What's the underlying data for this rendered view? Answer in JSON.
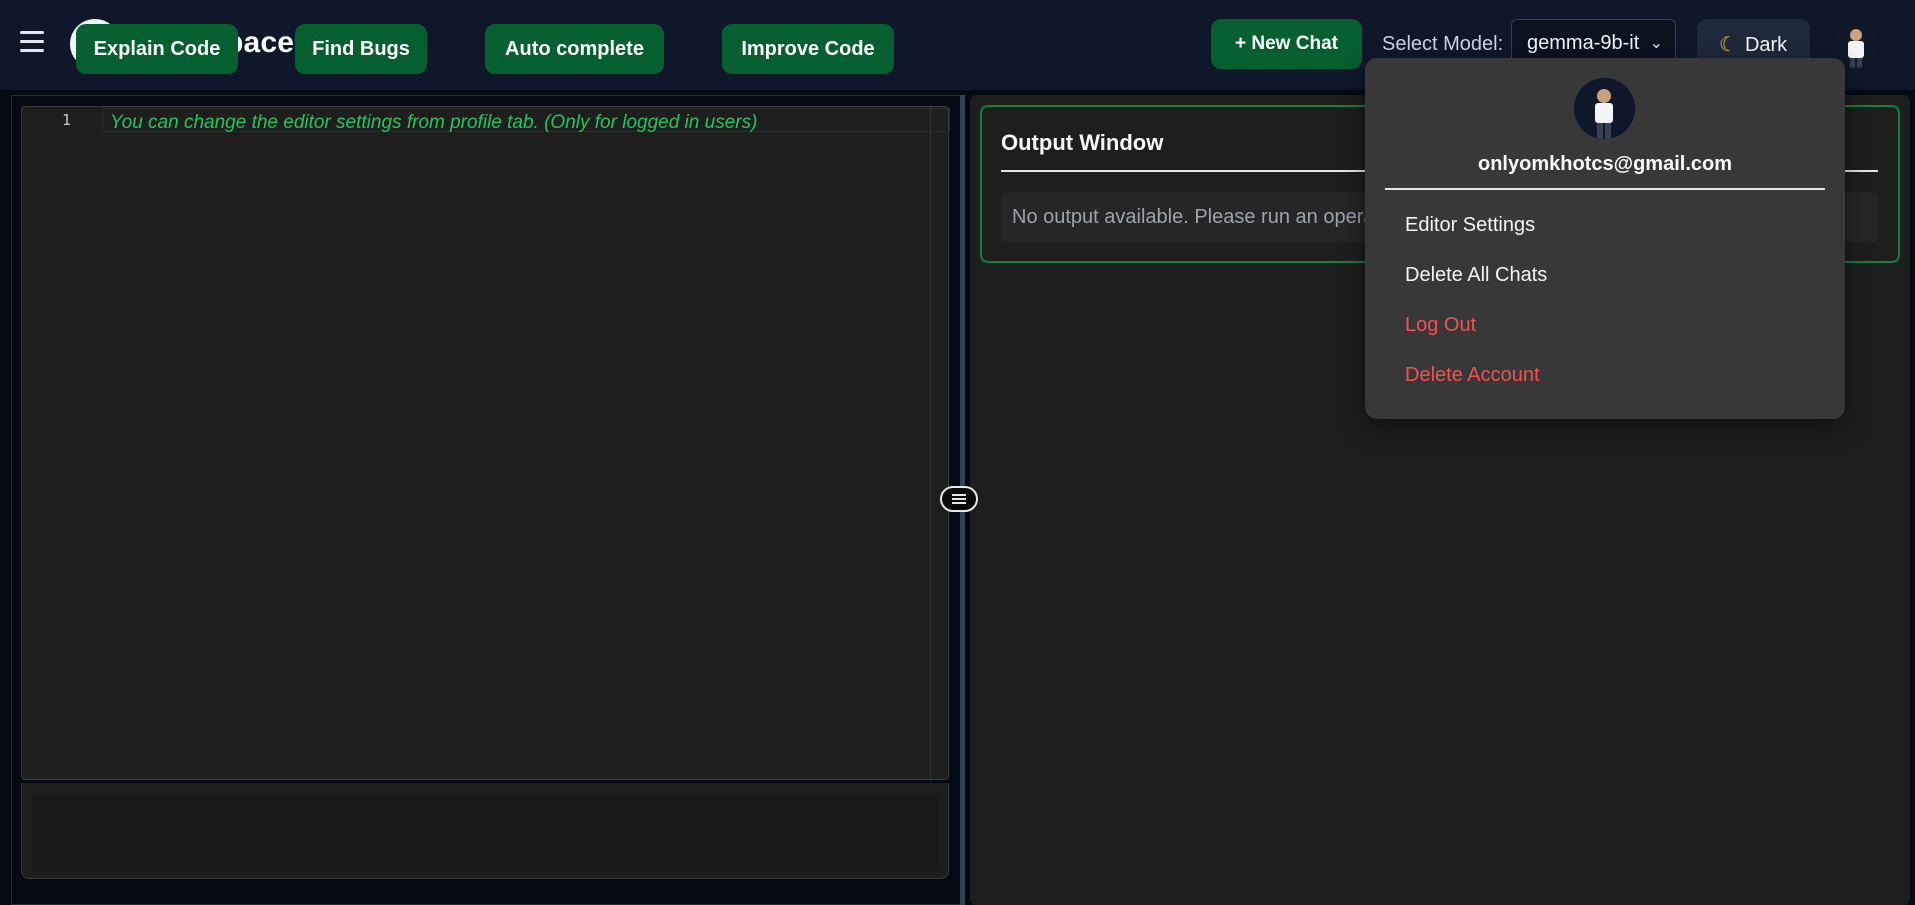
{
  "header": {
    "app_name": "CodeSpace",
    "new_chat_label": "+ New Chat",
    "model_label": "Select Model:",
    "model_selected": "gemma-9b-it",
    "theme_label": "Dark"
  },
  "editor": {
    "line_number": "1",
    "hint": "You can change the editor settings from profile tab. (Only for logged in users)"
  },
  "actions": [
    "Explain Code",
    "Find Bugs",
    "Auto complete",
    "Improve Code"
  ],
  "output": {
    "title": "Output Window",
    "message": "No output available. Please run an operation to see output here."
  },
  "profile_menu": {
    "email": "onlyomkhotcs@gmail.com",
    "items": [
      "Editor Settings",
      "Delete All Chats",
      "Log Out",
      "Delete Account"
    ]
  },
  "colors": {
    "accent_green": "#065f2e",
    "hint_green": "#22c55e",
    "danger_red": "#f05252",
    "header_bg": "#0f172a"
  },
  "icons": [
    "menu-icon",
    "logo-icon",
    "chevron-down-icon",
    "moon-icon",
    "avatar",
    "drag-handle-icon"
  ]
}
